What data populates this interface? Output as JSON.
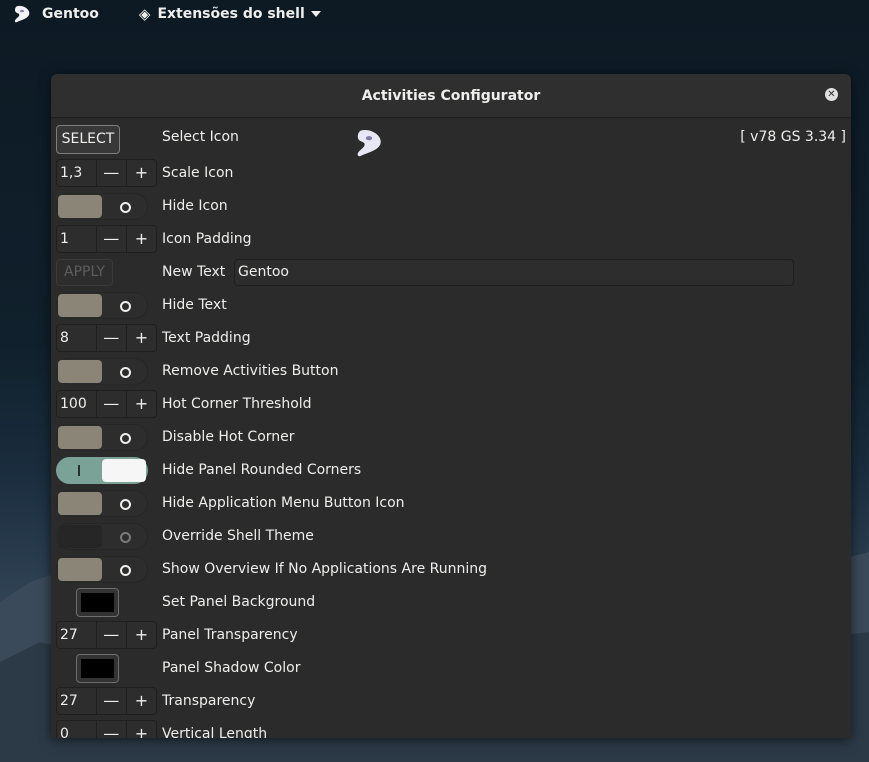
{
  "topbar": {
    "activities_label": "Gentoo",
    "app_menu_label": "Extensões do shell"
  },
  "window": {
    "title": "Activities Configurator"
  },
  "header": {
    "select_button": "SELECT",
    "select_label": "Select Icon",
    "version": "[ v78 GS 3.34 ]"
  },
  "settings": {
    "scale_icon": {
      "value": "1,3",
      "label": "Scale Icon"
    },
    "hide_icon": {
      "label": "Hide Icon",
      "on": false
    },
    "icon_padding": {
      "value": "1",
      "label": "Icon Padding"
    },
    "new_text": {
      "button": "APPLY",
      "label": "New Text",
      "value": "Gentoo"
    },
    "hide_text": {
      "label": "Hide Text",
      "on": false
    },
    "text_padding": {
      "value": "8",
      "label": "Text Padding"
    },
    "remove_activities": {
      "label": "Remove Activities Button",
      "on": false
    },
    "hot_corner_threshold": {
      "value": "100",
      "label": "Hot Corner Threshold"
    },
    "disable_hot_corner": {
      "label": "Disable Hot Corner",
      "on": false
    },
    "hide_rounded_corners": {
      "label": "Hide Panel Rounded Corners",
      "on": true
    },
    "hide_app_menu_icon": {
      "label": "Hide Application Menu Button Icon",
      "on": false
    },
    "override_theme": {
      "label": "Override Shell Theme",
      "on": false
    },
    "show_overview": {
      "label": "Show Overview If No Applications Are Running",
      "on": false
    },
    "panel_background": {
      "label": "Set Panel Background",
      "color": "#000000"
    },
    "panel_transparency": {
      "value": "27",
      "label": "Panel Transparency"
    },
    "panel_shadow_color": {
      "label": "Panel Shadow Color",
      "color": "#000000"
    },
    "transparency": {
      "value": "27",
      "label": "Transparency"
    },
    "vertical_length": {
      "value": "0",
      "label": "Vertical Length"
    }
  },
  "spin_symbols": {
    "minus": "—",
    "plus": "+"
  },
  "colors": {
    "accent_switch_on": "#7aa297",
    "switch_knob": "#8a8576",
    "window_bg": "#2b2b2b"
  }
}
